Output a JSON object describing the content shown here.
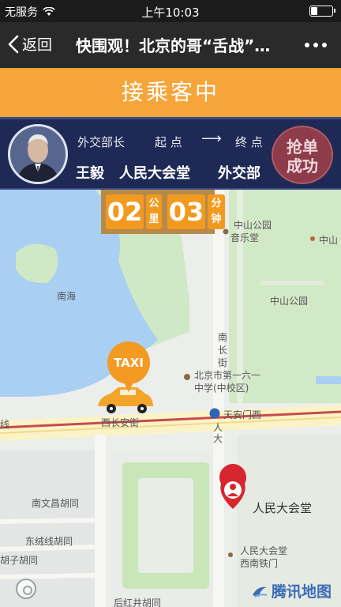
{
  "status_bar": {
    "carrier": "无服务",
    "time": "上午10:03"
  },
  "nav": {
    "back_label": "返回",
    "title": "快围观！北京的哥“舌战”…"
  },
  "banner": {
    "text": "接乘客中"
  },
  "passenger": {
    "title": "外交部长",
    "name": "王毅",
    "start_label": "起 点",
    "arrow": "⟶",
    "end_label": "终 点",
    "start_place": "人民大会堂",
    "end_place": "外交部",
    "grab_line1": "抢单",
    "grab_line2": "成功"
  },
  "counter": {
    "distance": "02",
    "distance_unit_1": "公",
    "distance_unit_2": "里",
    "time": "03",
    "time_unit_1": "分",
    "time_unit_2": "钟"
  },
  "map": {
    "taxi_label": "TAXI",
    "labels": {
      "zhongshan_park_music": "中山公园",
      "music_hall": "音乐堂",
      "zhongshan_right": "中山",
      "zhongshan_park": "中山公园",
      "nanhai": "南海",
      "nanchang_1": "南",
      "nanchang_2": "长",
      "nanchang_3": "街",
      "school_1": "北京市第一六一",
      "school_2": "中学(中校区)",
      "xichang_an": "西长安街",
      "tiananmen_west": "天安门西",
      "people_1": "人",
      "people_2": "大",
      "line_left": "线",
      "nanwenchang": "南文昌胡同",
      "dongrongxian": "东绒线胡同",
      "hutong_left": "胡子胡同",
      "great_hall": "人民大会堂",
      "gate_1": "人民大会堂",
      "gate_2": "西南铁门",
      "qianhong": "后红井胡同",
      "map_logo": "腾讯地图"
    }
  },
  "colors": {
    "banner": "#f5a53a",
    "panel": "#1e2a55",
    "counter": "#f29a20",
    "water": "#a9cff3",
    "park": "#cfe8c6"
  }
}
